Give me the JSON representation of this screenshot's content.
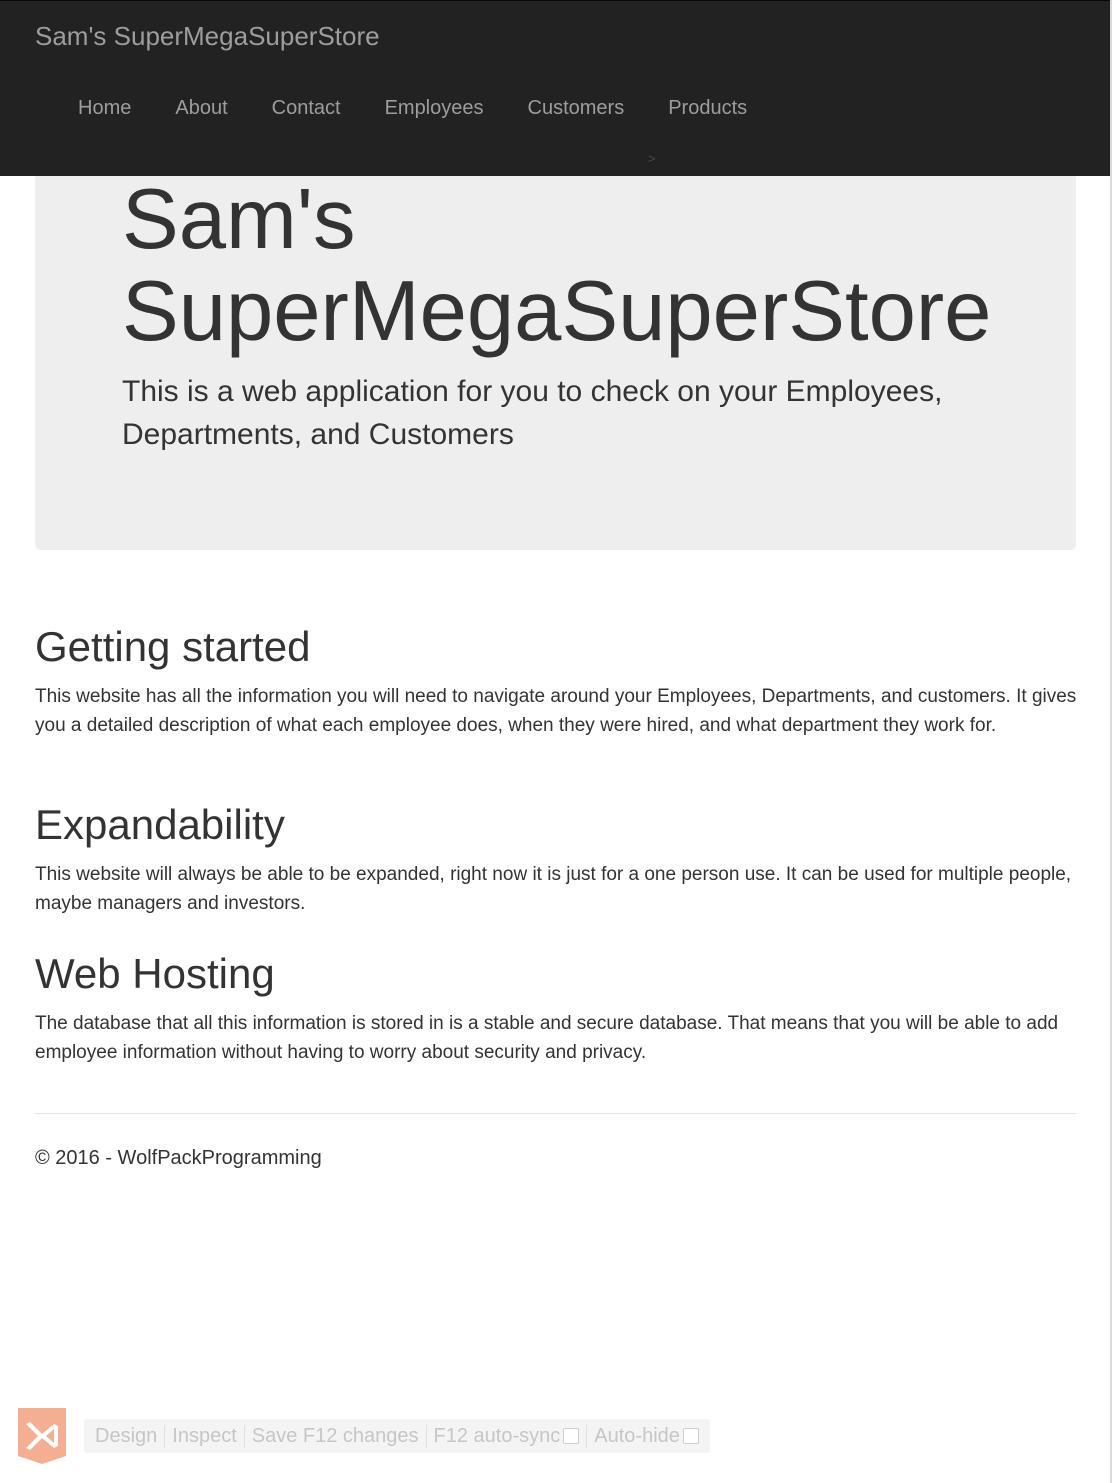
{
  "navbar": {
    "brand": "Sam's SuperMegaSuperStore",
    "links": [
      "Home",
      "About",
      "Contact",
      "Employees",
      "Customers",
      "Products"
    ],
    "caret": ">"
  },
  "jumbotron": {
    "title": "Sam's SuperMegaSuperStore",
    "lead": "This is a web application for you to check on your Employees, Departments, and Customers"
  },
  "sections": [
    {
      "heading": "Getting started",
      "text": "This website has all the information you will need to navigate around your Employees, Departments, and customers. It gives you a detailed description of what each employee does, when they were hired, and what department they work for."
    },
    {
      "heading": "Expandability",
      "text": "This website will always be able to be expanded, right now it is just for a one person use. It can be used for multiple people, maybe managers and investors."
    },
    {
      "heading": "Web Hosting",
      "text": "The database that all this information is stored in is a stable and secure database. That means that you will be able to add employee information without having to worry about security and privacy."
    }
  ],
  "footer": {
    "text": "© 2016 - WolfPackProgramming"
  },
  "browser_link": {
    "logo": "visual-studio-icon",
    "items": [
      "Design",
      "Inspect",
      "Save F12 changes",
      "F12 auto-sync",
      "Auto-hide"
    ]
  },
  "colors": {
    "navbar_bg": "#222222",
    "nav_text": "#9d9d9d",
    "jumbotron_bg": "#eeeeee",
    "body_text": "#333333",
    "vs_logo": "#f2a07e"
  }
}
